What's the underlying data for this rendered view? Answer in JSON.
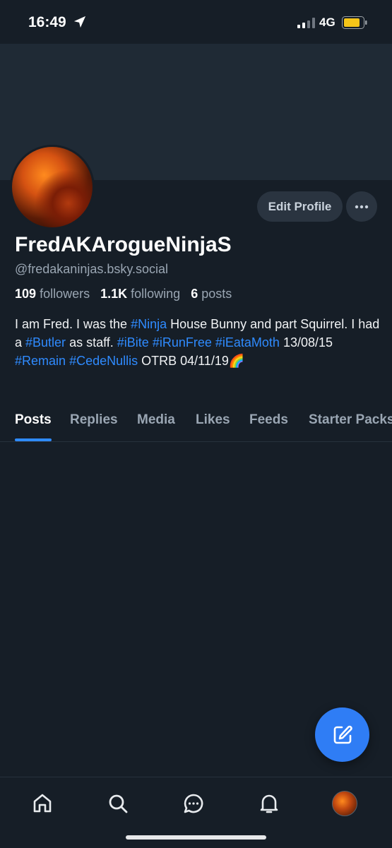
{
  "status_bar": {
    "time": "16:49",
    "network": "4G",
    "icons": [
      "location-arrow-icon",
      "signal-bars-icon",
      "battery-icon"
    ],
    "battery_color": "#f5c518"
  },
  "profile": {
    "display_name": "FredAKArogueNinjaS",
    "handle": "@fredakaninjas.bsky.social",
    "edit_label": "Edit Profile",
    "more_icon": "ellipsis-icon",
    "stats": {
      "followers_count": "109",
      "followers_label": "followers",
      "following_count": "1.1K",
      "following_label": "following",
      "posts_count": "6",
      "posts_label": "posts"
    },
    "bio": [
      {
        "text": "I am Fred. I was the ",
        "tag": false
      },
      {
        "text": "#Ninja",
        "tag": true
      },
      {
        "text": " House Bunny and part Squirrel. I had a ",
        "tag": false
      },
      {
        "text": "#Butler",
        "tag": true
      },
      {
        "text": " as staff. ",
        "tag": false
      },
      {
        "text": "#iBite",
        "tag": true
      },
      {
        "text": " ",
        "tag": false
      },
      {
        "text": "#iRunFree",
        "tag": true
      },
      {
        "text": " ",
        "tag": false
      },
      {
        "text": "#iEataMoth",
        "tag": true
      },
      {
        "text": " 13/08/15 ",
        "tag": false
      },
      {
        "text": "#Remain",
        "tag": true
      },
      {
        "text": " ",
        "tag": false
      },
      {
        "text": "#CedeNullis",
        "tag": true
      },
      {
        "text": " OTRB 04/11/19",
        "tag": false
      },
      {
        "text": "🌈",
        "tag": false
      }
    ]
  },
  "tabs": [
    "Posts",
    "Replies",
    "Media",
    "Likes",
    "Feeds",
    "Starter Packs"
  ],
  "active_tab": "Posts",
  "fab_icon": "compose-icon",
  "bottom_nav": [
    "home-icon",
    "search-icon",
    "chat-icon",
    "bell-icon",
    "profile-avatar"
  ],
  "colors": {
    "background": "#161e27",
    "banner": "#1f2a35",
    "accent": "#2f8bff",
    "fab": "#2f7df5",
    "button_bg": "#2a3440",
    "muted_text": "#9aa6b3"
  }
}
